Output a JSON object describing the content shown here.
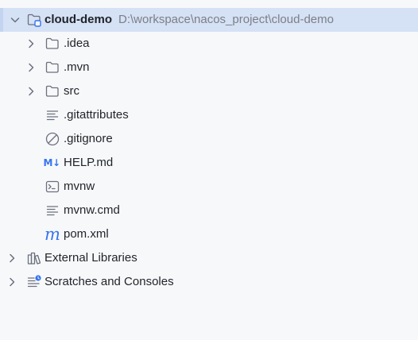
{
  "project": {
    "name": "cloud-demo",
    "path": "D:\\workspace\\nacos_project\\cloud-demo"
  },
  "items": [
    {
      "label": ".idea",
      "icon": "folder-icon",
      "expandable": true
    },
    {
      "label": ".mvn",
      "icon": "folder-icon",
      "expandable": true
    },
    {
      "label": "src",
      "icon": "folder-icon",
      "expandable": true
    },
    {
      "label": ".gitattributes",
      "icon": "text-file-icon",
      "expandable": false
    },
    {
      "label": ".gitignore",
      "icon": "ignore-file-icon",
      "expandable": false
    },
    {
      "label": "HELP.md",
      "icon": "markdown-icon",
      "icon_text": "M↓",
      "expandable": false
    },
    {
      "label": "mvnw",
      "icon": "shell-script-icon",
      "expandable": false
    },
    {
      "label": "mvnw.cmd",
      "icon": "text-file-icon",
      "expandable": false
    },
    {
      "label": "pom.xml",
      "icon": "maven-icon",
      "icon_text": "m",
      "expandable": false
    }
  ],
  "external_libraries": {
    "label": "External Libraries",
    "icon": "library-icon"
  },
  "scratches": {
    "label": "Scratches and Consoles",
    "icon": "scratches-icon"
  },
  "colors": {
    "selection": "#d5e1f5",
    "accent": "#3574f0",
    "path_text": "#7c7f86",
    "icon_gray": "#6c707e"
  }
}
